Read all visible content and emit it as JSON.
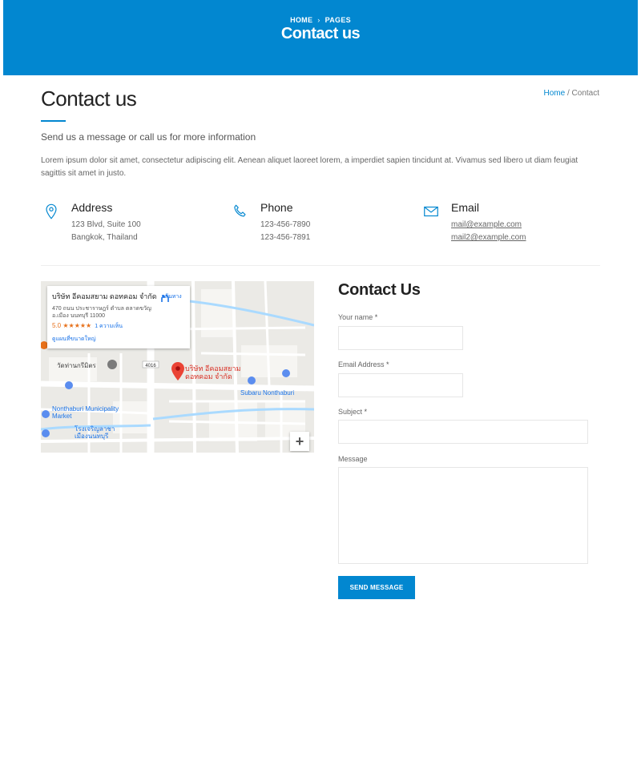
{
  "hero": {
    "breadcrumb": [
      "HOME",
      "PAGES"
    ],
    "breadcrumb_sep": "›",
    "title": "Contact us"
  },
  "page": {
    "title": "Contact us",
    "crumb_home": "Home",
    "crumb_sep": " / ",
    "crumb_current": "Contact",
    "subtitle": "Send us a message or call us for more information",
    "lorem": "Lorem ipsum dolor sit amet, consectetur adipiscing elit. Aenean aliquet laoreet lorem, a imperdiet sapien tincidunt at. Vivamus sed libero ut diam feugiat sagittis sit amet in justo."
  },
  "info": {
    "address": {
      "title": "Address",
      "line1": "123 Blvd, Suite 100",
      "line2": "Bangkok, Thailand",
      "icon": "map-pin-icon"
    },
    "phone": {
      "title": "Phone",
      "line1": "123-456-7890",
      "line2": "123-456-7891",
      "icon": "phone-icon"
    },
    "email": {
      "title": "Email",
      "line1": "mail@example.com",
      "line2": "mail2@example.com",
      "icon": "envelope-icon"
    }
  },
  "map": {
    "place_name": "บริษัท อีคอมสยาม ดอทคอม จำกัด",
    "place_address": "470 ถนน ประชาราษฎร์ ตำบล ตลาดขวัญ อ.เมือง นนทบุรี 11000",
    "rating": "5.0",
    "stars": "★★★★★",
    "reviews": "1 ความเห็น",
    "larger_map": "ดูแผนที่ขนาดใหญ่",
    "directions": "เส้นทาง",
    "pin_label": "บริษัท อีคอมสยาม ดอทคอม จำกัด",
    "road_badge": "4016",
    "labels": {
      "market": "วัดท่านกรีมิตร",
      "subaru": "Subaru Nonthaburi",
      "muni": "Nonthaburi Municipality Market",
      "hospital": "โรงเจริญลาชา เมืองนนทบุรี"
    },
    "zoom_in": "+"
  },
  "form": {
    "title": "Contact Us",
    "name_label": "Your name",
    "email_label": "Email Address",
    "subject_label": "Subject",
    "message_label": "Message",
    "required_mark": "*",
    "name_value": "",
    "email_value": "",
    "subject_value": "",
    "message_value": "",
    "submit": "SEND MESSAGE"
  },
  "colors": {
    "accent": "#0287d0",
    "heading": "#222222",
    "body": "#666666"
  }
}
